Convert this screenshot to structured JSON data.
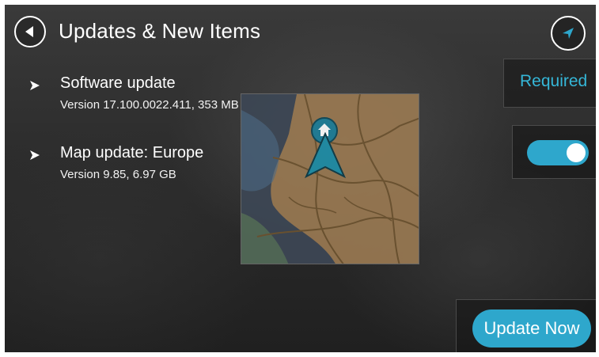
{
  "header": {
    "title": "Updates & New Items",
    "back_icon": "back-arrow-icon",
    "nav_icon": "navigation-arrow-icon"
  },
  "updates": [
    {
      "label": "Software update",
      "detail": "Version 17.100.0022.411, 353 MB"
    },
    {
      "label": "Map update: Europe",
      "detail": "Version 9.85, 6.97 GB"
    }
  ],
  "status": {
    "required_label": "Required",
    "toggle_on": true
  },
  "actions": {
    "update_now_label": "Update Now"
  },
  "colors": {
    "accent": "#2ea7cc",
    "accent_text": "#35b7d8",
    "background": "#2c2c2c"
  }
}
